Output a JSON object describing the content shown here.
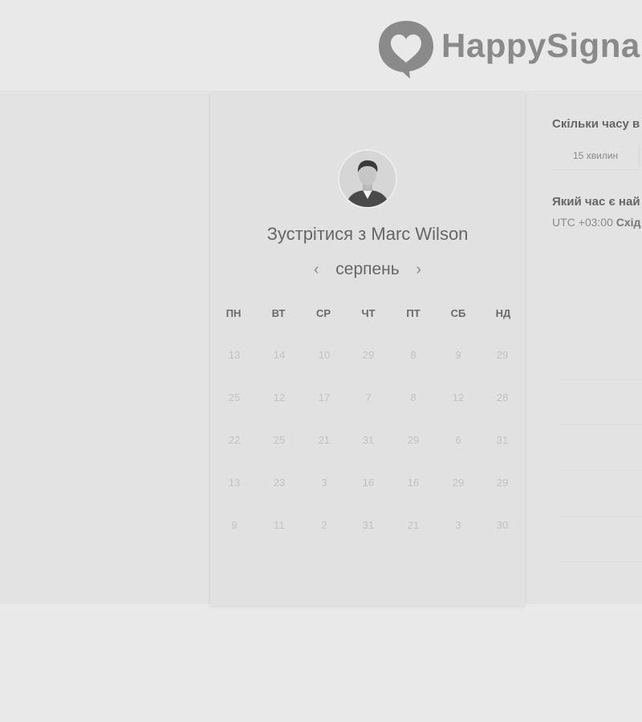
{
  "brand": {
    "name": "HappySigna",
    "logo_icon": "heart-speech-bubble-icon"
  },
  "calendar": {
    "title": "Зустрітися з Marc Wilson",
    "month": "серпень",
    "prev_icon": "chevron-left-icon",
    "next_icon": "chevron-right-icon",
    "weekdays": [
      "ПН",
      "ВТ",
      "СР",
      "ЧТ",
      "ПТ",
      "СБ",
      "НД"
    ],
    "weeks": [
      [
        "13",
        "14",
        "10",
        "29",
        "8",
        "9",
        "29"
      ],
      [
        "25",
        "12",
        "17",
        "7",
        "8",
        "12",
        "28"
      ],
      [
        "22",
        "25",
        "21",
        "31",
        "29",
        "6",
        "31"
      ],
      [
        "13",
        "23",
        "3",
        "16",
        "16",
        "29",
        "29"
      ],
      [
        "9",
        "11",
        "2",
        "31",
        "21",
        "3",
        "30"
      ]
    ]
  },
  "booking": {
    "duration_question": "Скільки часу в",
    "duration_option": "15 хвилин",
    "time_question": "Який час є най",
    "timezone_offset": "UTC +03:00",
    "timezone_name": "Схід"
  },
  "colors": {
    "background": "#e9e9e9",
    "card": "#e1e1e1",
    "text": "#666666",
    "muted_day": "#c2c2c2"
  }
}
